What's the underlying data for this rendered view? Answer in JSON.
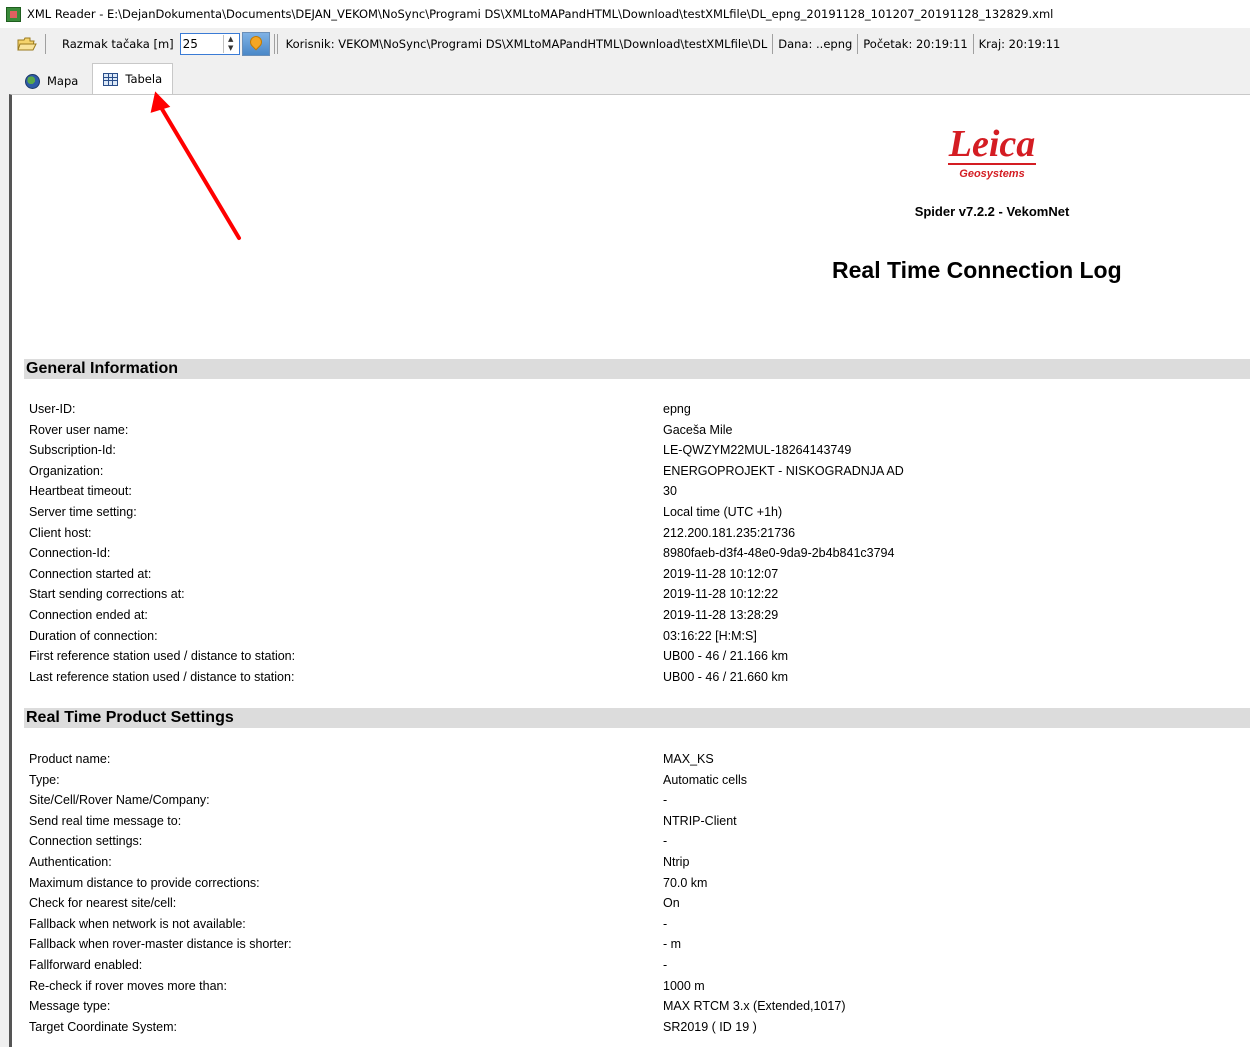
{
  "window": {
    "title": "XML Reader - E:\\DejanDokumenta\\Documents\\DEJAN_VEKOM\\NoSync\\Programi DS\\XMLtoMAPandHTML\\Download\\testXMLfile\\DL_epng_20191128_101207_20191128_132829.xml"
  },
  "toolbar": {
    "razmak_label": "Razmak tačaka [m]",
    "razmak_value": "25",
    "korisnik": "Korisnik: VEKOM\\NoSync\\Programi DS\\XMLtoMAPandHTML\\Download\\testXMLfile\\DL",
    "dana": "Dana: ..epng",
    "pocetak": "Početak: 20:19:11",
    "kraj": "Kraj: 20:19:11"
  },
  "tabs": [
    {
      "label": "Mapa",
      "icon": "globe-icon",
      "active": false
    },
    {
      "label": "Tabela",
      "icon": "table-icon",
      "active": true
    }
  ],
  "report": {
    "logo_word": "Leica",
    "logo_sub": "Geosystems",
    "software": "Spider v7.2.2 - VekomNet",
    "title": "Real Time Connection Log",
    "general": {
      "heading": "General Information",
      "rows": [
        {
          "k": "User-ID:",
          "v": "epng"
        },
        {
          "k": "Rover user name:",
          "v": "Gaceša Mile"
        },
        {
          "k": "Subscription-Id:",
          "v": "LE-QWZYM22MUL-18264143749"
        },
        {
          "k": "Organization:",
          "v": "ENERGOPROJEKT - NISKOGRADNJA AD"
        },
        {
          "k": "Heartbeat timeout:",
          "v": "30"
        },
        {
          "k": "Server time setting:",
          "v": "Local time (UTC +1h)"
        },
        {
          "k": "Client host:",
          "v": "212.200.181.235:21736"
        },
        {
          "k": "Connection-Id:",
          "v": "8980faeb-d3f4-48e0-9da9-2b4b841c3794"
        },
        {
          "k": "Connection started at:",
          "v": "2019-11-28 10:12:07"
        },
        {
          "k": "Start sending corrections at:",
          "v": "2019-11-28 10:12:22"
        },
        {
          "k": "Connection ended at:",
          "v": "2019-11-28 13:28:29"
        },
        {
          "k": "Duration of connection:",
          "v": "03:16:22 [H:M:S]"
        },
        {
          "k": "First reference station used / distance to station:",
          "v": "UB00 - 46 / 21.166 km"
        },
        {
          "k": "Last reference station used / distance to station:",
          "v": "UB00 - 46 / 21.660 km"
        }
      ]
    },
    "product": {
      "heading": "Real Time Product Settings",
      "rows": [
        {
          "k": "Product name:",
          "v": "MAX_KS"
        },
        {
          "k": "Type:",
          "v": "Automatic cells"
        },
        {
          "k": "Site/Cell/Rover Name/Company:",
          "v": "-"
        },
        {
          "k": "Send real time message to:",
          "v": "NTRIP-Client"
        },
        {
          "k": "Connection settings:",
          "v": "-"
        },
        {
          "k": "Authentication:",
          "v": "Ntrip"
        },
        {
          "k": "Maximum distance to provide corrections:",
          "v": "70.0 km"
        },
        {
          "k": "Check for nearest site/cell:",
          "v": "On"
        },
        {
          "k": "Fallback when network is not available:",
          "v": "-"
        },
        {
          "k": "Fallback when rover-master distance is shorter:",
          "v": "- m"
        },
        {
          "k": "Fallforward enabled:",
          "v": "-"
        },
        {
          "k": "Re-check if rover moves more than:",
          "v": "1000 m"
        },
        {
          "k": "Message type:",
          "v": "MAX RTCM 3.x (Extended,1017)"
        },
        {
          "k": "Target Coordinate System:",
          "v": "SR2019 ( ID 19 )"
        }
      ]
    }
  },
  "colors": {
    "brand_red": "#d41d23",
    "annotation_arrow": "#ff0000",
    "section_bg": "#dcdcdc"
  }
}
